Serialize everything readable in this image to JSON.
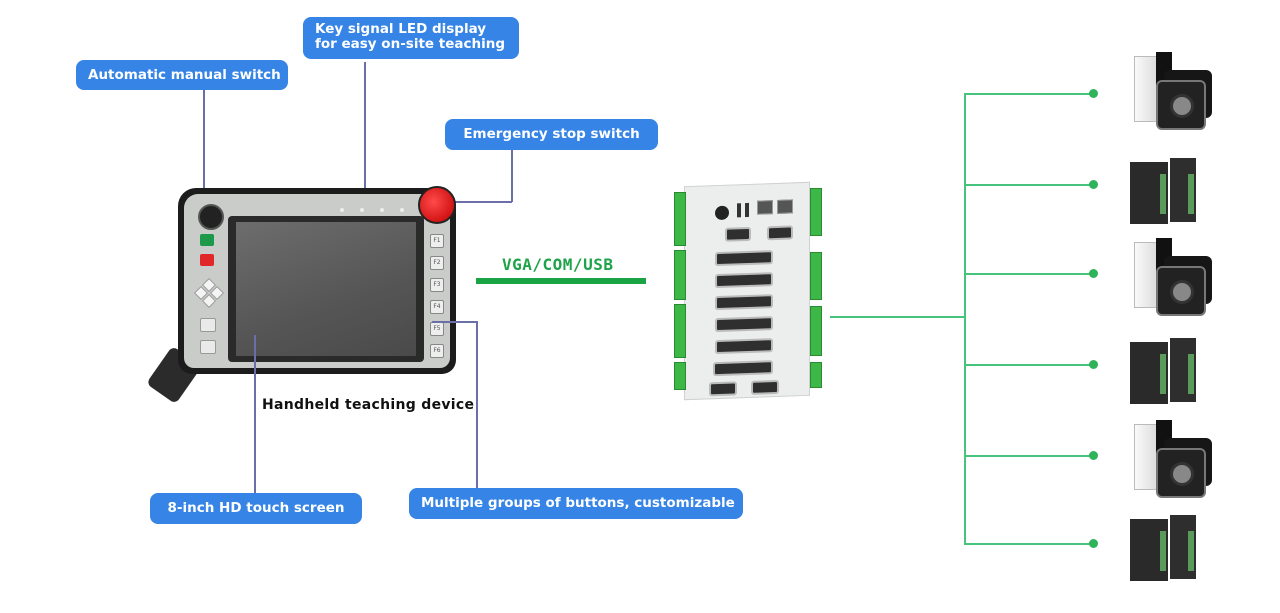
{
  "callouts": {
    "led_display": "Key signal LED display\nfor easy on-site teaching",
    "led_display_line1": "Key signal LED display",
    "led_display_line2": "for easy on-site teaching",
    "auto_manual": "Automatic manual switch",
    "emergency_stop": "Emergency stop switch",
    "touch_screen": "8-inch HD touch screen",
    "buttons": "Multiple groups of buttons, customizable"
  },
  "device_label": "Handheld teaching device",
  "bus_label": "VGA/COM/USB",
  "pendant": {
    "function_keys": [
      "F1",
      "F2",
      "F3",
      "F4",
      "F5",
      "F6"
    ],
    "led_count": 4
  },
  "servo_units": [
    {
      "type": "servo-motor-with-drive"
    },
    {
      "type": "servo-drive-pair"
    },
    {
      "type": "servo-motor-with-drive"
    },
    {
      "type": "servo-drive-pair"
    },
    {
      "type": "servo-motor-with-drive"
    },
    {
      "type": "servo-drive-pair"
    }
  ],
  "colors": {
    "callout_bg": "#3584e6",
    "leader": "#6b6fa8",
    "bus_green": "#1aa446",
    "branch_green": "#47c47c"
  }
}
